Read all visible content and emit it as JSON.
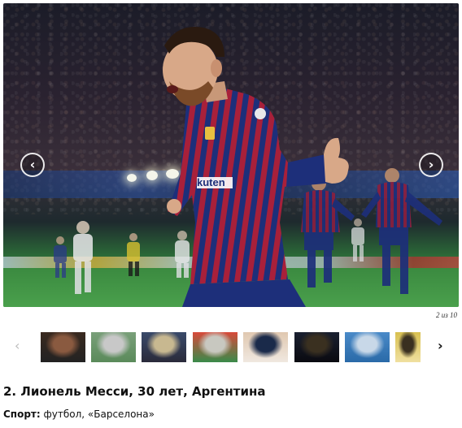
{
  "gallery": {
    "main_image": {
      "alt": "",
      "sponsor_text": "kuten"
    },
    "nav_prev_icon": "chevron-left-icon",
    "nav_next_icon": "chevron-right-icon",
    "prev_glyph": "‹",
    "next_glyph": "›",
    "counter": "2 из 10",
    "thumbnails": [
      {
        "id": 1,
        "colors": [
          "#3a2a20",
          "#8a5a40",
          "#222"
        ]
      },
      {
        "id": 2,
        "colors": [
          "#7aa07a",
          "#c8c8c8",
          "#5a8a5a"
        ]
      },
      {
        "id": 3,
        "colors": [
          "#3a4a6a",
          "#c8b890",
          "#2a2a3a"
        ]
      },
      {
        "id": 4,
        "colors": [
          "#d84a3a",
          "#c8c8c0",
          "#3a8a4a"
        ]
      },
      {
        "id": 5,
        "colors": [
          "#e0c8b0",
          "#1a2a4a",
          "#f0e8e0"
        ]
      },
      {
        "id": 6,
        "colors": [
          "#1a2030",
          "#3a3020",
          "#0a0a10"
        ]
      },
      {
        "id": 7,
        "colors": [
          "#4a8ac8",
          "#c8d8e8",
          "#2a6aa8"
        ]
      },
      {
        "id": 8,
        "colors": [
          "#d8c050",
          "#3a3020",
          "#f0e0a0"
        ]
      }
    ],
    "thumb_prev_glyph": "‹",
    "thumb_next_glyph": "›"
  },
  "article": {
    "title": "2. Лионель Месси, 30 лет, Аргентина",
    "meta_label": "Спорт:",
    "meta_value": " футбол, «Барселона»"
  },
  "colors": {
    "shirt_blue": "#1d2f7a",
    "shirt_red": "#a8203a",
    "pitch_green": "#3f9448"
  }
}
